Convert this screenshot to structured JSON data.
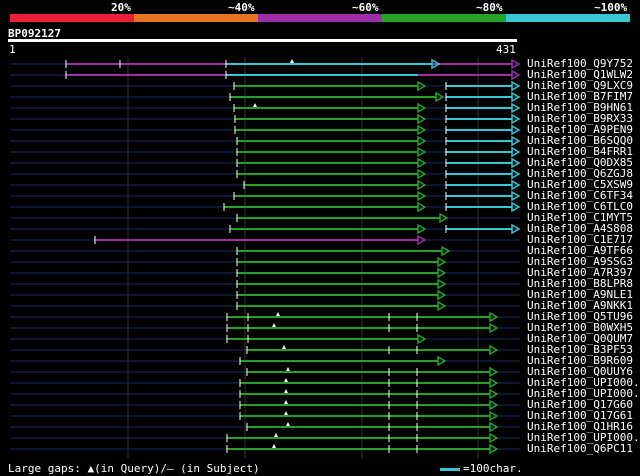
{
  "legend": {
    "labels": [
      "20%",
      "~40%",
      "~60%",
      "~80%",
      "~100%"
    ],
    "colors": [
      "#e8203a",
      "#e87420",
      "#9a2fa8",
      "#22a422",
      "#33c8d2"
    ]
  },
  "query": {
    "id": "BP092127",
    "start": "1",
    "end": "431"
  },
  "hits": [
    "UniRef100_Q9Y752",
    "UniRef100_Q1WLW2",
    "UniRef100_Q9LXC9",
    "UniRef100_B7FIM7",
    "UniRef100_B9HN61",
    "UniRef100_B9RX33",
    "UniRef100_A9PEN9",
    "UniRef100_B6SQQ0",
    "UniRef100_B4FRR1",
    "UniRef100_Q0DX85",
    "UniRef100_Q6ZGJ8",
    "UniRef100_C5XSW9",
    "UniRef100_C6TF34",
    "UniRef100_C6TLC0",
    "UniRef100_C1MYT5",
    "UniRef100_A4S808",
    "UniRef100_C1E717",
    "UniRef100_A9TF66",
    "UniRef100_A9SSG3",
    "UniRef100_A7R397",
    "UniRef100_B8LPR8",
    "UniRef100_A9NLE1",
    "UniRef100_A9NKK1",
    "UniRef100_Q5TU96",
    "UniRef100_B0WXH5",
    "UniRef100_Q0QUM7",
    "UniRef100_B3PF53",
    "UniRef100_B9R609",
    "UniRef100_Q0UUY6",
    "UniRef100_UPI000..",
    "UniRef100_UPI000..",
    "UniRef100_Q17G60",
    "UniRef100_Q17G61",
    "UniRef100_Q1HR16",
    "UniRef100_UPI000..",
    "UniRef100_Q6PC11"
  ],
  "footer": {
    "gaps_text": "Large gaps: ▲(in Query)/– (in Subject)",
    "scale_text": "=100char."
  }
}
